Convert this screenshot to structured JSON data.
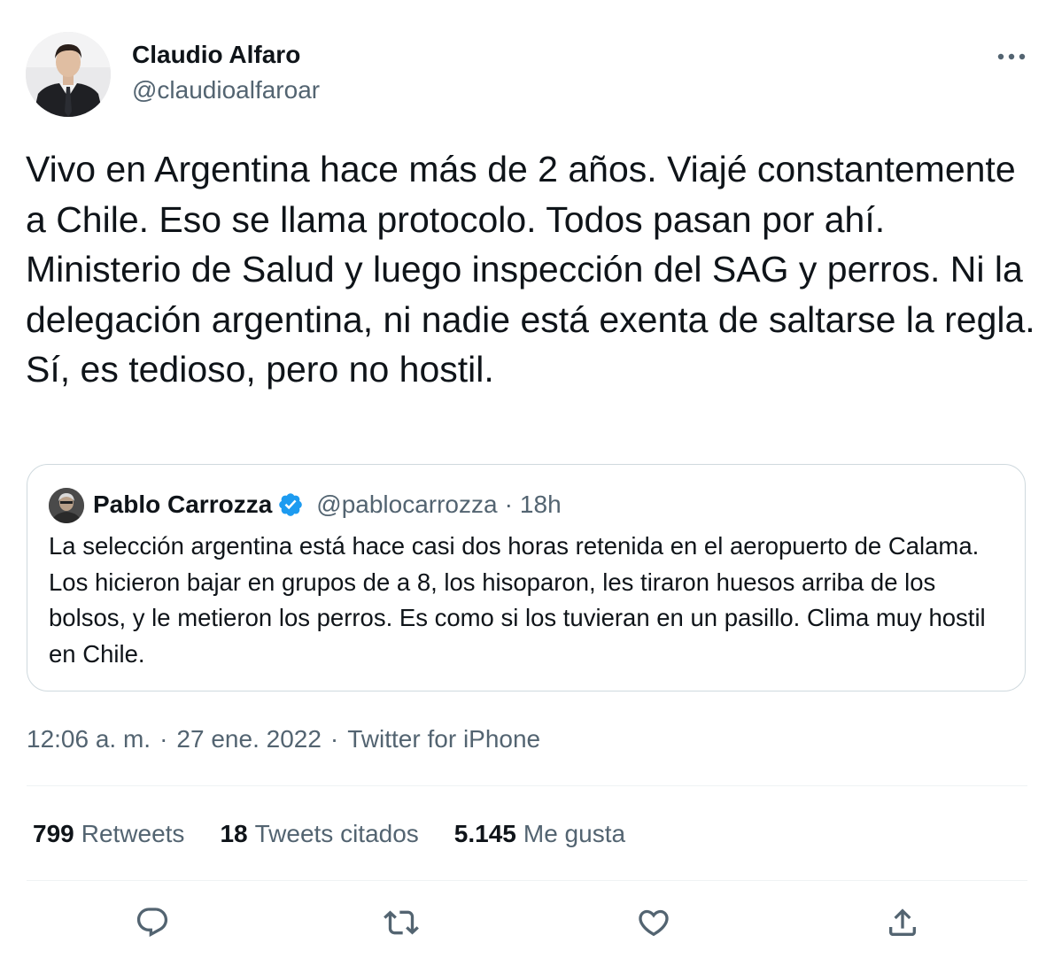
{
  "author": {
    "name": "Claudio Alfaro",
    "handle": "@claudioalfaroar"
  },
  "tweet": {
    "text": "Vivo en Argentina hace más de 2 años. Viajé constantemente a Chile. Eso se llama protocolo. Todos pasan por ahí. Ministerio de Salud y luego inspección del SAG y perros. Ni la delegación argentina, ni nadie está exenta de saltarse la regla. Sí, es tedioso, pero no hostil."
  },
  "quoted_tweet": {
    "name": "Pablo Carrozza",
    "handle": "@pablocarrozza",
    "separator": "·",
    "time": "18h",
    "text": "La selección argentina está hace casi dos horas retenida en el aeropuerto de Calama. Los hicieron bajar en grupos de a 8, los hisoparon, les tiraron huesos arriba de los bolsos, y le metieron los perros. Es como si los tuvieran en un pasillo. Clima muy hostil en Chile."
  },
  "meta": {
    "time": "12:06 a. m.",
    "date": "27 ene. 2022",
    "separator": "·",
    "source": "Twitter for iPhone"
  },
  "stats": {
    "retweets": {
      "count": "799",
      "label": "Retweets"
    },
    "quotes": {
      "count": "18",
      "label": "Tweets citados"
    },
    "likes": {
      "count": "5.145",
      "label": "Me gusta"
    }
  },
  "actions": [
    "reply-icon",
    "retweet-icon",
    "like-icon",
    "share-icon"
  ],
  "colors": {
    "text_primary": "#0f1419",
    "text_secondary": "#536471",
    "border": "#cfd9de",
    "divider": "#eff3f4",
    "verified": "#1d9bf0"
  }
}
